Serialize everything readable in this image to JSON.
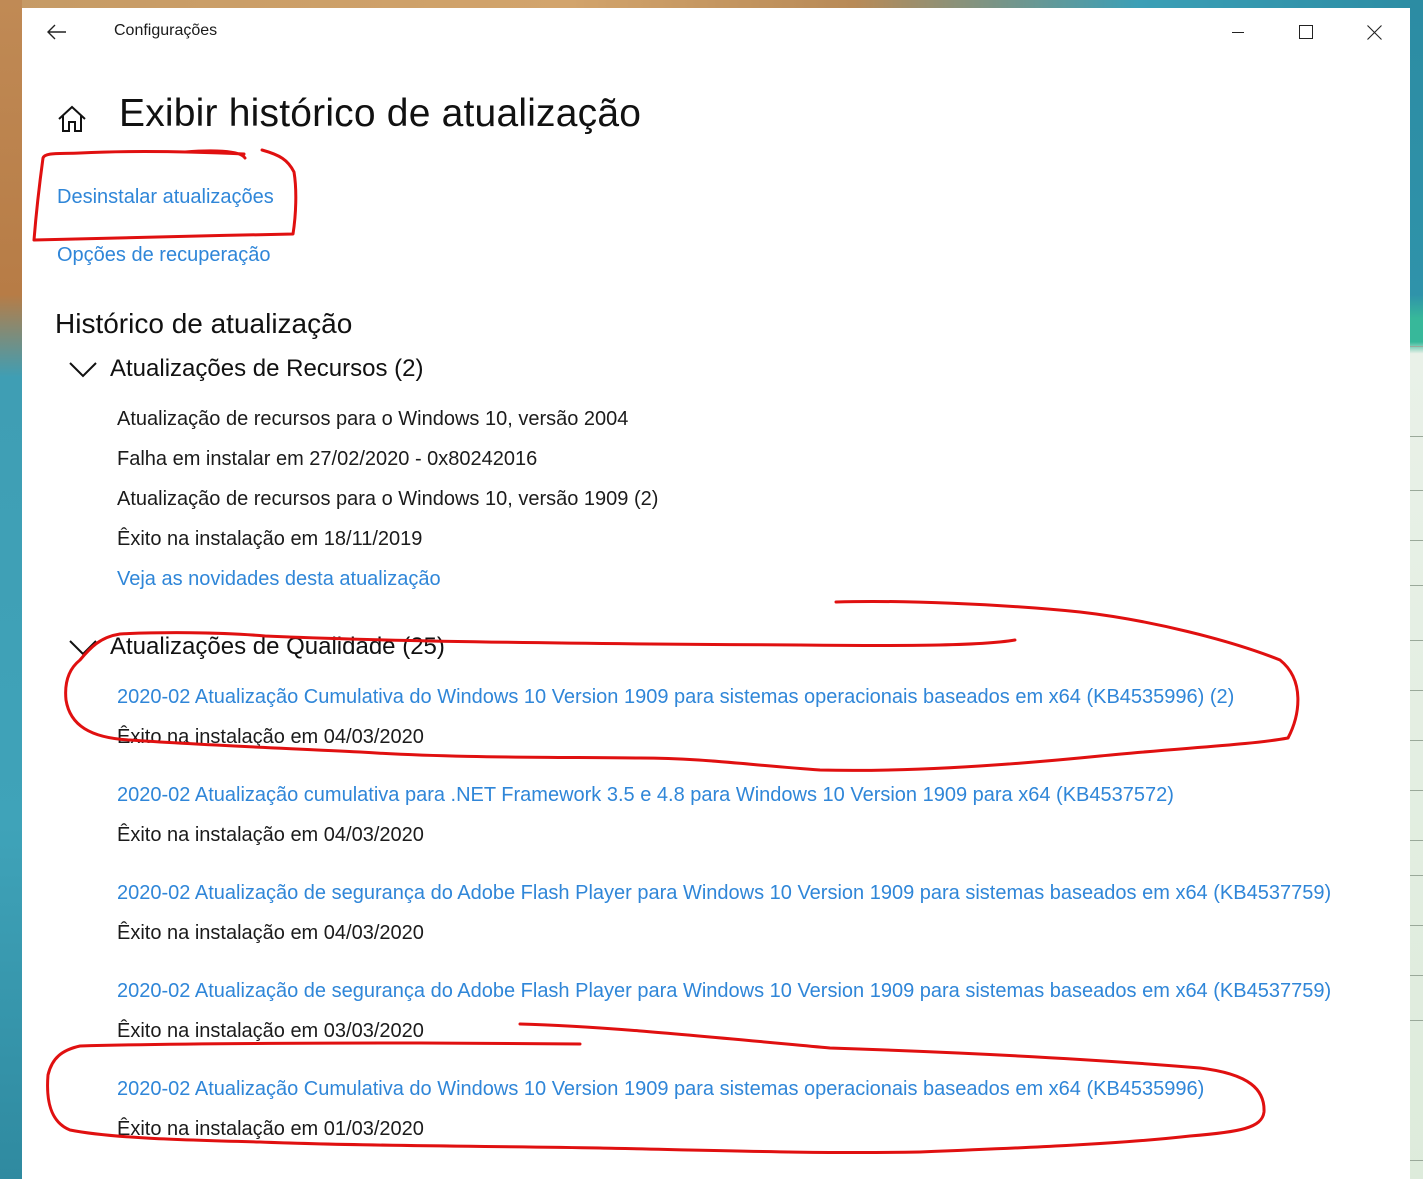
{
  "window": {
    "app_title": "Configurações"
  },
  "page": {
    "title": "Exibir histórico de atualização"
  },
  "links": {
    "uninstall": "Desinstalar atualizações",
    "recovery": "Opções de recuperação"
  },
  "history": {
    "section_title": "Histórico de atualização",
    "feature": {
      "header": "Atualizações de Recursos (2)",
      "items": [
        {
          "title": "Atualização de recursos para o Windows 10, versão 2004",
          "status": "Falha em instalar em 27/02/2020 - 0x80242016"
        },
        {
          "title": "Atualização de recursos para o Windows 10, versão 1909 (2)",
          "status": "Êxito na instalação em 18/11/2019"
        }
      ],
      "whats_new": "Veja as novidades desta atualização"
    },
    "quality": {
      "header": "Atualizações de Qualidade (25)",
      "items": [
        {
          "title": "2020-02 Atualização Cumulativa do Windows 10 Version 1909 para sistemas operacionais baseados em x64 (KB4535996) (2)",
          "status": "Êxito na instalação em 04/03/2020"
        },
        {
          "title": "2020-02 Atualização cumulativa para .NET Framework 3.5 e 4.8 para Windows 10 Version 1909 para x64 (KB4537572)",
          "status": "Êxito na instalação em 04/03/2020"
        },
        {
          "title": "2020-02 Atualização de segurança do Adobe Flash Player para Windows 10 Version 1909 para sistemas baseados em x64 (KB4537759)",
          "status": "Êxito na instalação em 04/03/2020"
        },
        {
          "title": "2020-02 Atualização de segurança do Adobe Flash Player para Windows 10 Version 1909 para sistemas baseados em x64 (KB4537759)",
          "status": "Êxito na instalação em 03/03/2020"
        },
        {
          "title": "2020-02 Atualização Cumulativa do Windows 10 Version 1909 para sistemas operacionais baseados em x64 (KB4535996)",
          "status": "Êxito na instalação em 01/03/2020"
        }
      ]
    }
  },
  "colors": {
    "link": "#2f86d8",
    "text": "#1b1b1b",
    "annotation": "#e01010"
  },
  "icons": [
    "back-arrow-icon",
    "minimize-icon",
    "maximize-icon",
    "close-icon",
    "home-icon",
    "chevron-down-icon"
  ]
}
